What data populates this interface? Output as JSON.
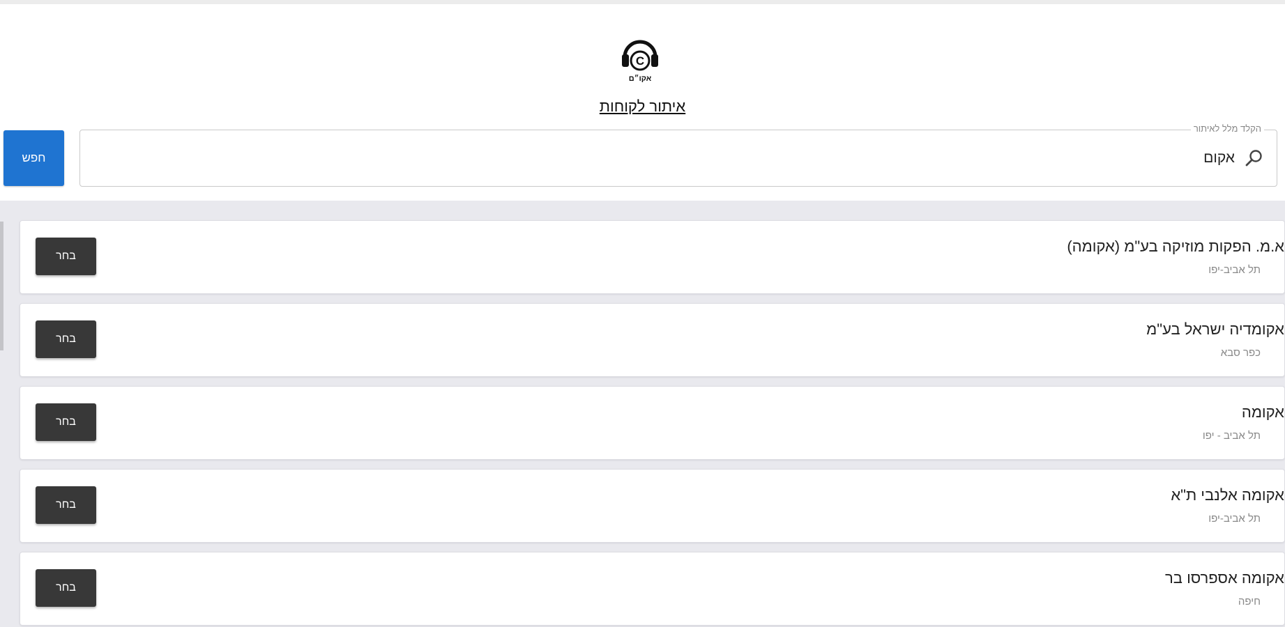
{
  "header": {
    "logo_icon": "headset-copyright-logo-icon",
    "logo_text": "אקו״ם",
    "title": "איתור לקוחות"
  },
  "search": {
    "label": "הקלד מלל לאיתור",
    "value": "אקום",
    "button_label": "חפש",
    "icon": "search-icon",
    "button_color": "#1f74d1"
  },
  "results": [
    {
      "name": "א.מ. הפקות מוזיקה בע\"מ (אקומה)",
      "city": "תל אביב-יפו",
      "button_label": "בחר"
    },
    {
      "name": "אקומדיה ישראל בע\"מ",
      "city": "כפר סבא",
      "button_label": "בחר"
    },
    {
      "name": "אקומה",
      "city": "תל אביב - יפו",
      "button_label": "בחר"
    },
    {
      "name": "אקומה אלנבי ת\"א",
      "city": "תל אביב-יפו",
      "button_label": "בחר"
    },
    {
      "name": "אקומה אספרסו בר",
      "city": "חיפה",
      "button_label": "בחר"
    }
  ],
  "colors": {
    "select_button": "#383838",
    "panel_background": "#e9e9ee"
  }
}
